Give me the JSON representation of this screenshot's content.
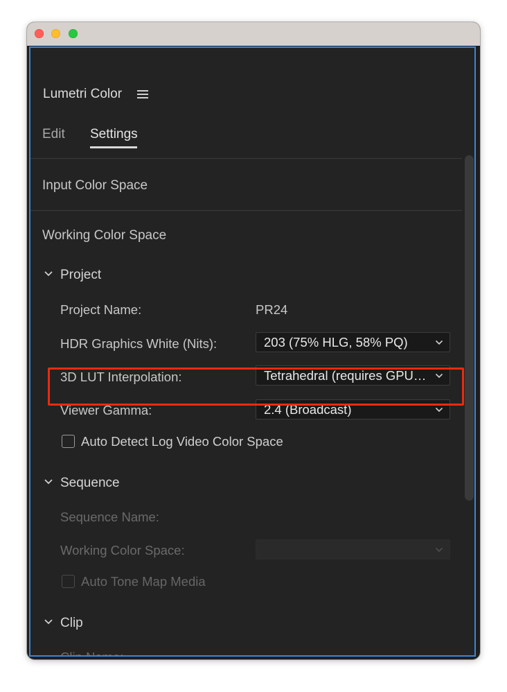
{
  "window": {
    "controls": [
      "close",
      "minimize",
      "maximize"
    ]
  },
  "panel": {
    "title": "Lumetri Color",
    "menu_icon": "hamburger-menu-icon",
    "tabs": [
      {
        "label": "Edit",
        "active": false
      },
      {
        "label": "Settings",
        "active": true
      }
    ]
  },
  "sections": {
    "input_color_space": "Input Color Space",
    "working_color_space": "Working Color Space"
  },
  "project": {
    "header": "Project",
    "name_label": "Project Name:",
    "name_value": "PR24",
    "hdr_label": "HDR Graphics White (Nits):",
    "hdr_value": "203 (75% HLG, 58% PQ)",
    "lut_label": "3D LUT Interpolation:",
    "lut_value": "Tetrahedral (requires GPU acceleration)",
    "gamma_label": "Viewer Gamma:",
    "gamma_value": "2.4 (Broadcast)",
    "auto_detect_label": "Auto Detect Log Video Color Space",
    "auto_detect_checked": false
  },
  "sequence": {
    "header": "Sequence",
    "name_label": "Sequence Name:",
    "working_label": "Working Color Space:",
    "working_value": "",
    "tone_map_label": "Auto Tone Map Media",
    "tone_map_checked": false
  },
  "clip": {
    "header": "Clip",
    "name_label": "Clip Name:"
  },
  "colors": {
    "accent": "#3b86d6",
    "highlight": "#ea2b10",
    "panel_bg": "#232323"
  }
}
